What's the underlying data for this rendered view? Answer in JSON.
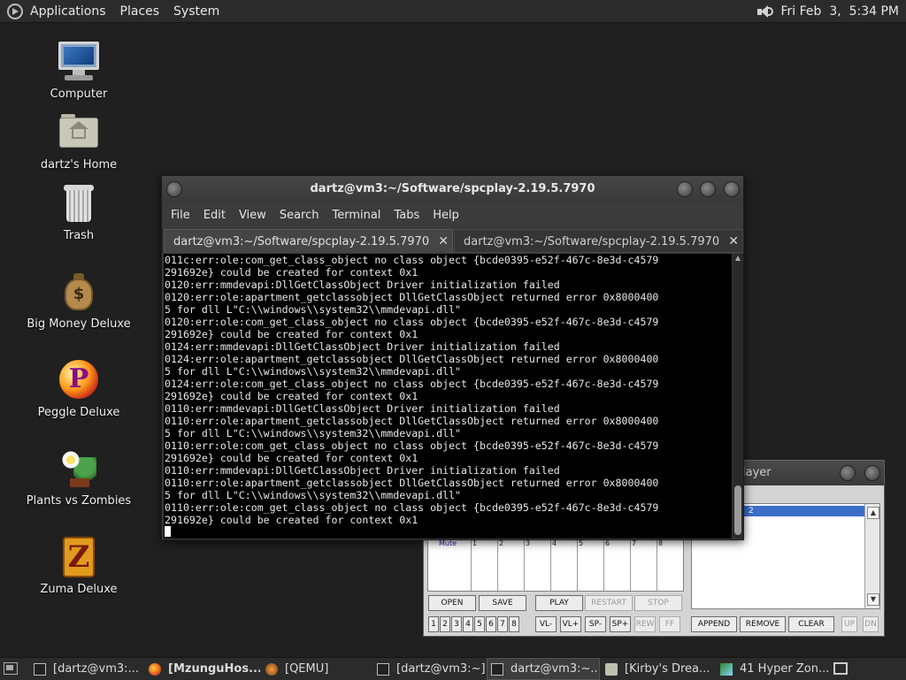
{
  "top_panel": {
    "menus": [
      "Applications",
      "Places",
      "System"
    ],
    "clock": "Fri Feb  3,  5:34 PM"
  },
  "desktop_icons": [
    {
      "label": "Computer",
      "icon": "computer-icon"
    },
    {
      "label": "dartz's Home",
      "icon": "home-folder-icon"
    },
    {
      "label": "Trash",
      "icon": "trash-icon"
    },
    {
      "label": "Big Money Deluxe",
      "icon": "money-bag-icon"
    },
    {
      "label": "Peggle Deluxe",
      "icon": "peggle-icon"
    },
    {
      "label": "Plants vs Zombies",
      "icon": "plants-vs-zombies-icon"
    },
    {
      "label": "Zuma Deluxe",
      "icon": "zuma-icon"
    }
  ],
  "terminal": {
    "title": "dartz@vm3:~/Software/spcplay-2.19.5.7970",
    "menu": [
      "File",
      "Edit",
      "View",
      "Search",
      "Terminal",
      "Tabs",
      "Help"
    ],
    "tabs": [
      {
        "label": "dartz@vm3:~/Software/spcplay-2.19.5.7970",
        "close": "✕"
      },
      {
        "label": "dartz@vm3:~/Software/spcplay-2.19.5.7970",
        "close": "✕"
      }
    ],
    "lines": [
      "011c:err:ole:com_get_class_object no class object {bcde0395-e52f-467c-8e3d-c4579",
      "291692e} could be created for context 0x1",
      "0120:err:mmdevapi:DllGetClassObject Driver initialization failed",
      "0120:err:ole:apartment_getclassobject DllGetClassObject returned error 0x8000400",
      "5 for dll L\"C:\\\\windows\\\\system32\\\\mmdevapi.dll\"",
      "0120:err:ole:com_get_class_object no class object {bcde0395-e52f-467c-8e3d-c4579",
      "291692e} could be created for context 0x1",
      "0124:err:mmdevapi:DllGetClassObject Driver initialization failed",
      "0124:err:ole:apartment_getclassobject DllGetClassObject returned error 0x8000400",
      "5 for dll L\"C:\\\\windows\\\\system32\\\\mmdevapi.dll\"",
      "0124:err:ole:com_get_class_object no class object {bcde0395-e52f-467c-8e3d-c4579",
      "291692e} could be created for context 0x1",
      "0110:err:mmdevapi:DllGetClassObject Driver initialization failed",
      "0110:err:ole:apartment_getclassobject DllGetClassObject returned error 0x8000400",
      "5 for dll L\"C:\\\\windows\\\\system32\\\\mmdevapi.dll\"",
      "0110:err:ole:com_get_class_object no class object {bcde0395-e52f-467c-8e3d-c4579",
      "291692e} could be created for context 0x1",
      "0110:err:mmdevapi:DllGetClassObject Driver initialization failed",
      "0110:err:ole:apartment_getclassobject DllGetClassObject returned error 0x8000400",
      "5 for dll L\"C:\\\\windows\\\\system32\\\\mmdevapi.dll\"",
      "0110:err:ole:com_get_class_object no class object {bcde0395-e52f-467c-8e3d-c4579",
      "291692e} could be created for context 0x1"
    ]
  },
  "spc_player": {
    "title_fragment": "layer",
    "vis_label": "Mute",
    "channels": [
      "1",
      "2",
      "3",
      "4",
      "5",
      "6",
      "7",
      "8"
    ],
    "playlist_item": "2",
    "buttons_row1": [
      {
        "label": "OPEN",
        "enabled": true
      },
      {
        "label": "SAVE",
        "enabled": true
      },
      {
        "label": "PLAY",
        "enabled": true
      },
      {
        "label": "RESTART",
        "enabled": false
      },
      {
        "label": "STOP",
        "enabled": false
      }
    ],
    "channel_buttons": [
      "1",
      "2",
      "3",
      "4",
      "5",
      "6",
      "7",
      "8"
    ],
    "buttons_row2": [
      {
        "label": "VL-",
        "enabled": true
      },
      {
        "label": "VL+",
        "enabled": true
      },
      {
        "label": "SP-",
        "enabled": true
      },
      {
        "label": "SP+",
        "enabled": true
      },
      {
        "label": "REW",
        "enabled": false
      },
      {
        "label": "FF",
        "enabled": false
      }
    ],
    "playlist_buttons": [
      {
        "label": "APPEND",
        "enabled": true
      },
      {
        "label": "REMOVE",
        "enabled": true
      },
      {
        "label": "CLEAR",
        "enabled": true
      },
      {
        "label": "UP",
        "enabled": false
      },
      {
        "label": "DN",
        "enabled": false
      }
    ]
  },
  "taskbar": {
    "items": [
      {
        "label": "[dartz@vm3:...",
        "icon": "terminal-icon",
        "active": false
      },
      {
        "label": "[MzunguHos...",
        "icon": "firefox-icon",
        "active": false
      },
      {
        "label": "[QEMU]",
        "icon": "qemu-icon",
        "active": false
      },
      {
        "label": "[dartz@vm3:~]",
        "icon": "terminal-icon",
        "active": false
      },
      {
        "label": "dartz@vm3:~...",
        "icon": "terminal-icon",
        "active": true
      },
      {
        "label": "[Kirby's Drea...",
        "icon": "folder-icon",
        "active": false
      },
      {
        "label": "41 Hyper Zon...",
        "icon": "game-icon",
        "active": false
      }
    ]
  }
}
